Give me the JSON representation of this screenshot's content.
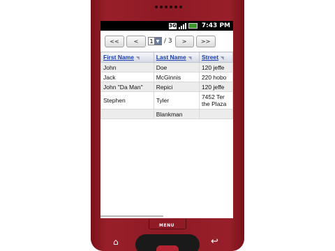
{
  "status_bar": {
    "time": "7:43 PM",
    "network_badge": "3G",
    "icons": [
      "network-3g-icon",
      "signal-icon",
      "battery-icon"
    ]
  },
  "pager": {
    "first": "<<",
    "prev": "<",
    "page_value": "1",
    "page_of": "/ 3",
    "next": ">",
    "last": ">>"
  },
  "table": {
    "columns": [
      "First Name",
      "Last Name",
      "Street"
    ],
    "rows": [
      {
        "first": "John",
        "last": "Doe",
        "street": "120 jeffe"
      },
      {
        "first": "Jack",
        "last": "McGinnis",
        "street": "220 hobo"
      },
      {
        "first": "John \"Da Man\"",
        "last": "Repici",
        "street": "120 jeffe"
      },
      {
        "first": "Stephen",
        "last": "Tyler",
        "street": "7452 Ter the Plaza"
      },
      {
        "first": "",
        "last": "Blankman",
        "street": ""
      }
    ]
  },
  "device": {
    "menu_label": "MENU",
    "body_color": "#8b1822"
  }
}
